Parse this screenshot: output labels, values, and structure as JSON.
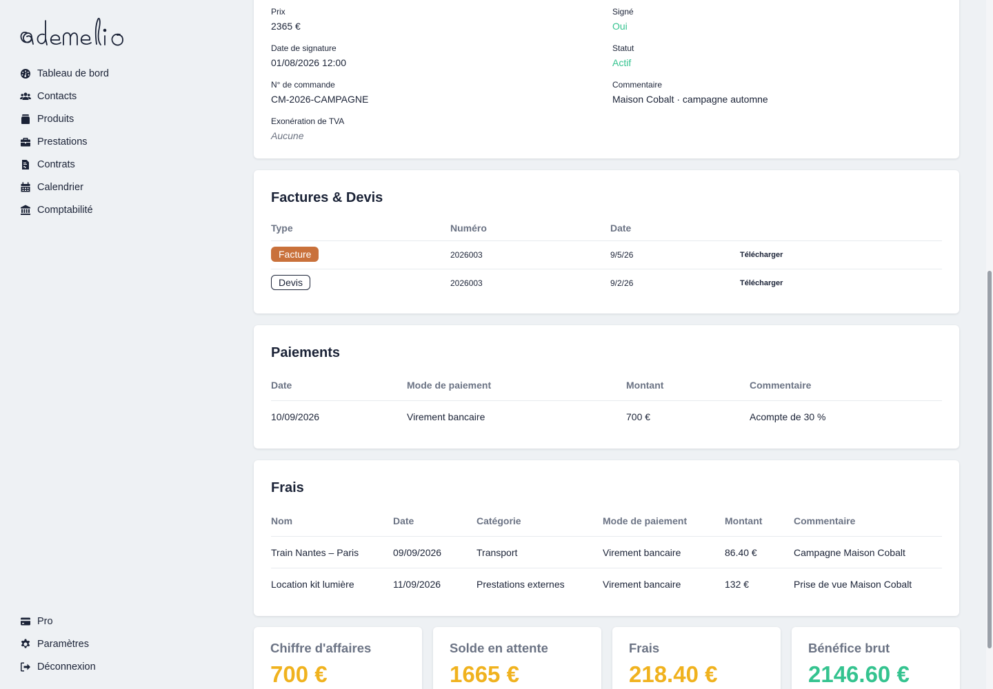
{
  "colors": {
    "green": "#34c38f",
    "orange": "#f0b21e",
    "facture_badge": "#c9713b",
    "text": "#1a2236",
    "muted": "#6b7384"
  },
  "sidebar": {
    "items": [
      {
        "label": "Tableau de bord",
        "icon": "dashboard-icon"
      },
      {
        "label": "Contacts",
        "icon": "users-icon"
      },
      {
        "label": "Produits",
        "icon": "box-icon"
      },
      {
        "label": "Prestations",
        "icon": "briefcase-icon"
      },
      {
        "label": "Contrats",
        "icon": "file-contract-icon"
      },
      {
        "label": "Calendrier",
        "icon": "calendar-icon"
      },
      {
        "label": "Comptabilité",
        "icon": "bank-icon"
      }
    ],
    "bottom": [
      {
        "label": "Pro",
        "icon": "credit-card-icon"
      },
      {
        "label": "Paramètres",
        "icon": "gear-icon"
      },
      {
        "label": "Déconnexion",
        "icon": "sign-out-icon"
      }
    ]
  },
  "details": {
    "prix_label": "Prix",
    "prix": "2365 €",
    "date_label": "Date de signature",
    "date": "01/08/2026 12:00",
    "commande_label": "N° de commande",
    "commande": "CM-2026-CAMPAGNE",
    "tva_label": "Exonération de TVA",
    "tva": "Aucune",
    "signe_label": "Signé",
    "signe": "Oui",
    "statut_label": "Statut",
    "statut": "Actif",
    "commentaire_label": "Commentaire",
    "commentaire": "Maison Cobalt · campagne automne"
  },
  "factures": {
    "title": "Factures & Devis",
    "headers": [
      "Type",
      "Numéro",
      "Date"
    ],
    "rows": [
      {
        "type": "Facture",
        "numero": "2026003",
        "date": "9/5/26",
        "action": "Télécharger"
      },
      {
        "type": "Devis",
        "numero": "2026003",
        "date": "9/2/26",
        "action": "Télécharger"
      }
    ]
  },
  "paiements": {
    "title": "Paiements",
    "headers": [
      "Date",
      "Mode de paiement",
      "Montant",
      "Commentaire"
    ],
    "rows": [
      {
        "date": "10/09/2026",
        "mode": "Virement bancaire",
        "montant": "700 €",
        "commentaire": "Acompte de 30 %"
      }
    ]
  },
  "frais": {
    "title": "Frais",
    "headers": [
      "Nom",
      "Date",
      "Catégorie",
      "Mode de paiement",
      "Montant",
      "Commentaire"
    ],
    "rows": [
      {
        "nom": "Train Nantes – Paris",
        "date": "09/09/2026",
        "categorie": "Transport",
        "mode": "Virement bancaire",
        "montant": "86.40 €",
        "commentaire": "Campagne Maison Cobalt"
      },
      {
        "nom": "Location kit lumière",
        "date": "11/09/2026",
        "categorie": "Prestations externes",
        "mode": "Virement bancaire",
        "montant": "132 €",
        "commentaire": "Prise de vue Maison Cobalt"
      }
    ]
  },
  "stats": [
    {
      "label": "Chiffre d'affaires",
      "value": "700 €",
      "color": "#f0b21e"
    },
    {
      "label": "Solde en attente",
      "value": "1665 €",
      "color": "#f0b21e"
    },
    {
      "label": "Frais",
      "value": "218.40 €",
      "color": "#f0b21e"
    },
    {
      "label": "Bénéfice brut",
      "value": "2146.60 €",
      "color": "#34c38f"
    }
  ]
}
